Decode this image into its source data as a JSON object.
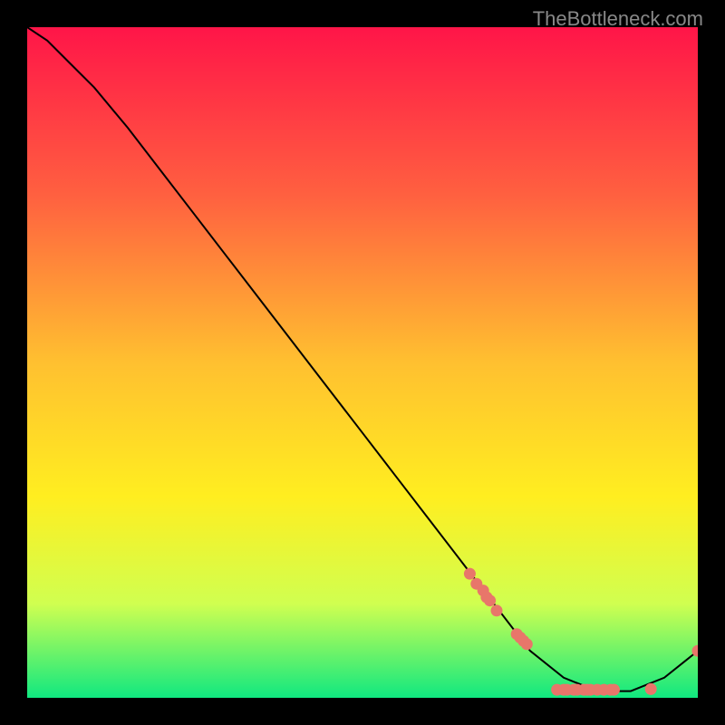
{
  "watermark": "TheBottleneck.com",
  "chart_data": {
    "type": "line",
    "title": "",
    "xlabel": "",
    "ylabel": "",
    "xlim": [
      0,
      100
    ],
    "ylim": [
      0,
      100
    ],
    "curve": {
      "x": [
        0,
        3,
        6,
        10,
        15,
        20,
        25,
        30,
        35,
        40,
        45,
        50,
        55,
        60,
        65,
        70,
        75,
        80,
        85,
        90,
        95,
        100
      ],
      "y": [
        100,
        98,
        95,
        91,
        85,
        78.5,
        72,
        65.5,
        59,
        52.5,
        46,
        39.5,
        33,
        26.5,
        20,
        13.5,
        7,
        3,
        1,
        1,
        3,
        7
      ]
    },
    "markers": [
      {
        "x": 66,
        "y": 18.5
      },
      {
        "x": 67,
        "y": 17
      },
      {
        "x": 68,
        "y": 16
      },
      {
        "x": 68.5,
        "y": 15
      },
      {
        "x": 69,
        "y": 14.5
      },
      {
        "x": 70,
        "y": 13
      },
      {
        "x": 73,
        "y": 9.5
      },
      {
        "x": 73.5,
        "y": 9
      },
      {
        "x": 74,
        "y": 8.5
      },
      {
        "x": 74.5,
        "y": 8
      },
      {
        "x": 79,
        "y": 1.2
      },
      {
        "x": 80,
        "y": 1.2
      },
      {
        "x": 80.5,
        "y": 1.2
      },
      {
        "x": 81.5,
        "y": 1.2
      },
      {
        "x": 82,
        "y": 1.2
      },
      {
        "x": 83,
        "y": 1.2
      },
      {
        "x": 83.5,
        "y": 1.2
      },
      {
        "x": 84,
        "y": 1.2
      },
      {
        "x": 85,
        "y": 1.2
      },
      {
        "x": 86,
        "y": 1.2
      },
      {
        "x": 87,
        "y": 1.2
      },
      {
        "x": 87.5,
        "y": 1.2
      },
      {
        "x": 93,
        "y": 1.3
      },
      {
        "x": 100,
        "y": 7
      }
    ],
    "gradient_colors": {
      "top": "#ff1548",
      "upper_mid": "#ff6040",
      "mid": "#ffc030",
      "lower_mid": "#ffee20",
      "lower": "#d0ff50",
      "bottom": "#10e880"
    },
    "marker_color": "#e8766a",
    "line_color": "#000000"
  }
}
